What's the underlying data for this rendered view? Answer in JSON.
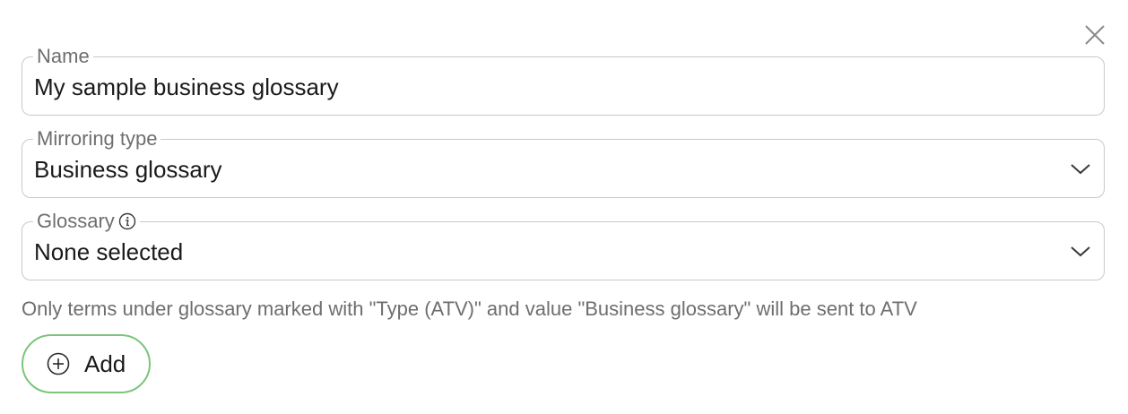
{
  "fields": {
    "name": {
      "label": "Name",
      "value": "My sample business glossary"
    },
    "mirroring_type": {
      "label": "Mirroring type",
      "value": "Business glossary"
    },
    "glossary": {
      "label": "Glossary",
      "value": "None selected"
    }
  },
  "hint": "Only terms under glossary marked with \"Type (ATV)\" and value \"Business glossary\" will be sent to ATV",
  "add_button": {
    "label": "Add"
  },
  "icons": {
    "close": "close-icon",
    "chevron": "chevron-down-icon",
    "info": "info-icon",
    "add": "plus-circle-icon"
  },
  "colors": {
    "add_border": "#7cc47a",
    "field_border": "#c9c9c9",
    "label_text": "#6e6e6e"
  }
}
